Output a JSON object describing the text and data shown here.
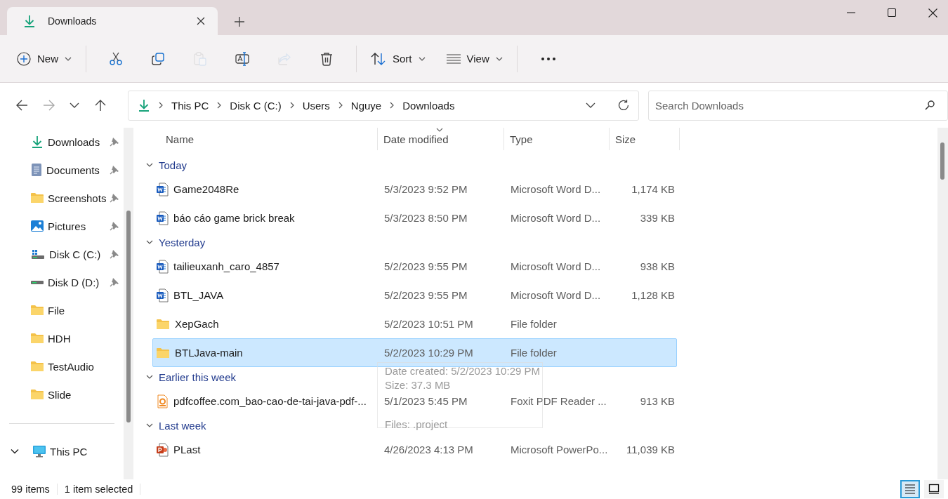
{
  "window": {
    "tab": {
      "label": "Downloads"
    }
  },
  "toolbar": {
    "new": {
      "label": "New"
    },
    "actions": [
      {
        "kind": "cut",
        "disabled": false
      },
      {
        "kind": "copy",
        "disabled": false
      },
      {
        "kind": "paste",
        "disabled": true
      },
      {
        "kind": "rename",
        "disabled": false
      },
      {
        "kind": "share",
        "disabled": true
      },
      {
        "kind": "delete",
        "disabled": false
      }
    ],
    "sort": {
      "label": "Sort"
    },
    "view": {
      "label": "View"
    }
  },
  "navigation": [
    {
      "kind": "back",
      "disabled": false
    },
    {
      "kind": "forward",
      "disabled": true
    },
    {
      "kind": "recent",
      "disabled": false
    },
    {
      "kind": "up",
      "disabled": false
    }
  ],
  "address": {
    "path": [
      "This PC",
      "Disk C (C:)",
      "Users",
      "Nguye",
      "Downloads"
    ]
  },
  "search": {
    "placeholder": "Search Downloads"
  },
  "sidebar": {
    "quick_access": [
      {
        "label": "Downloads",
        "kind": "download",
        "pinned": true
      },
      {
        "label": "Documents",
        "kind": "documents",
        "pinned": true
      },
      {
        "label": "Screenshots",
        "kind": "folder",
        "pinned": true
      },
      {
        "label": "Pictures",
        "kind": "pictures",
        "pinned": true
      },
      {
        "label": "Disk C (C:)",
        "kind": "drive-c",
        "pinned": true
      },
      {
        "label": "Disk D (D:)",
        "kind": "drive",
        "pinned": true
      },
      {
        "label": "File",
        "kind": "folder",
        "pinned": false
      },
      {
        "label": "HDH",
        "kind": "folder",
        "pinned": false
      },
      {
        "label": "TestAudio",
        "kind": "folder",
        "pinned": false
      },
      {
        "label": "Slide",
        "kind": "folder",
        "pinned": false
      }
    ],
    "tree": [
      {
        "label": "This PC",
        "kind": "pc",
        "expanded": true
      }
    ]
  },
  "columns": [
    {
      "label": "Name",
      "sorted": false
    },
    {
      "label": "Date modified",
      "sorted": true
    },
    {
      "label": "Type",
      "sorted": false
    },
    {
      "label": "Size",
      "sorted": false
    }
  ],
  "groups": [
    {
      "label": "Today",
      "expanded": true,
      "files": [
        {
          "name": "Game2048Re",
          "date": "5/3/2023 9:52 PM",
          "type": "Microsoft Word D...",
          "size": "1,174 KB",
          "kind": "word",
          "selected": false
        },
        {
          "name": "báo cáo game brick break",
          "date": "5/3/2023 8:50 PM",
          "type": "Microsoft Word D...",
          "size": "339 KB",
          "kind": "word",
          "selected": false
        }
      ]
    },
    {
      "label": "Yesterday",
      "expanded": true,
      "files": [
        {
          "name": "tailieuxanh_caro_4857",
          "date": "5/2/2023 9:55 PM",
          "type": "Microsoft Word D...",
          "size": "938 KB",
          "kind": "word",
          "selected": false
        },
        {
          "name": "BTL_JAVA",
          "date": "5/2/2023 9:55 PM",
          "type": "Microsoft Word D...",
          "size": "1,128 KB",
          "kind": "word",
          "selected": false
        },
        {
          "name": "XepGach",
          "date": "5/2/2023 10:51 PM",
          "type": "File folder",
          "kind": "folder",
          "selected": false
        },
        {
          "name": "BTLJava-main",
          "date": "5/2/2023 10:29 PM",
          "type": "File folder",
          "kind": "folder",
          "selected": true
        }
      ]
    },
    {
      "label": "Earlier this week",
      "expanded": true,
      "files": [
        {
          "name": "pdfcoffee.com_bao-cao-de-tai-java-pdf-...",
          "date": "5/1/2023 5:45 PM",
          "type": "Foxit PDF Reader ...",
          "size": "913 KB",
          "kind": "pdf",
          "selected": false
        }
      ]
    },
    {
      "label": "Last week",
      "expanded": true,
      "files": [
        {
          "name": "PLast",
          "date": "4/26/2023 4:13 PM",
          "type": "Microsoft PowerPo...",
          "size": "11,039 KB",
          "kind": "powerpoint",
          "selected": false
        }
      ]
    }
  ],
  "tooltip": {
    "lines": [
      "Date created: 5/2/2023 10:29 PM",
      "Size: 37.3 MB",
      "Files: .project"
    ]
  },
  "status_bar": {
    "item_count": "99 items",
    "selection": "1 item selected"
  },
  "view_modes": [
    {
      "kind": "details",
      "selected": true
    },
    {
      "kind": "tiles",
      "selected": false
    }
  ]
}
